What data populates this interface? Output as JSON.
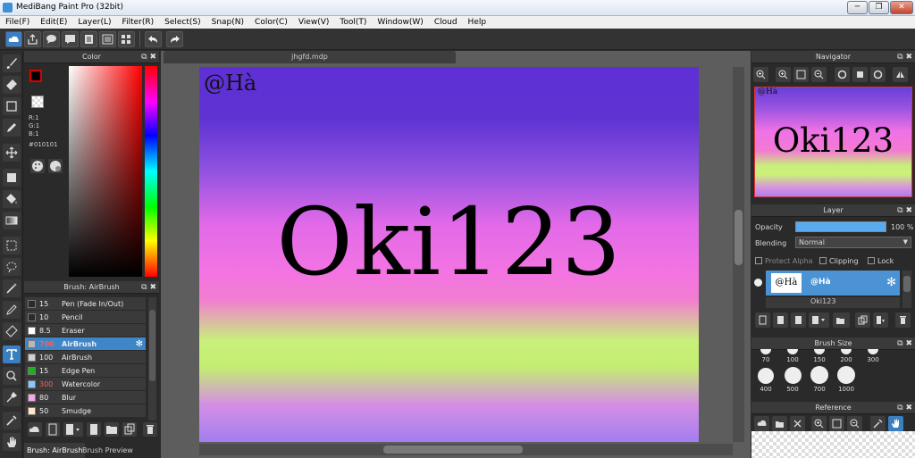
{
  "window": {
    "title": "MediBang Paint Pro (32bit)",
    "min_glyph": "─",
    "max_glyph": "❐",
    "close_glyph": "✕"
  },
  "menu": [
    "File(F)",
    "Edit(E)",
    "Layer(L)",
    "Filter(R)",
    "Select(S)",
    "Snap(N)",
    "Color(C)",
    "View(V)",
    "Tool(T)",
    "Window(W)",
    "Cloud",
    "Help"
  ],
  "panel_header_icons": "⧉ ✖",
  "color_panel": {
    "title": "Color",
    "rgb_lines": [
      "R:1",
      "G:1",
      "B:1"
    ],
    "hex": "#010101",
    "fg_color": "#010101"
  },
  "brush_panel": {
    "title": "Brush: AirBrush",
    "brushes": [
      {
        "size": "15",
        "name": "Pen (Fade In/Out)",
        "color": "#2a2a2a",
        "size_color": "#eeeeee",
        "active": false
      },
      {
        "size": "10",
        "name": "Pencil",
        "color": "#2a2a2a",
        "size_color": "#eeeeee",
        "active": false
      },
      {
        "size": "8.5",
        "name": "Eraser",
        "color": "#ffffff",
        "size_color": "#eeeeee",
        "active": false
      },
      {
        "size": "700",
        "name": "AirBrush",
        "color": "#b8b8b8",
        "size_color": "#f06262",
        "active": true
      },
      {
        "size": "100",
        "name": "AirBrush",
        "color": "#d0d0d0",
        "size_color": "#eeeeee",
        "active": false
      },
      {
        "size": "15",
        "name": "Edge Pen",
        "color": "#1db11d",
        "size_color": "#eeeeee",
        "active": false
      },
      {
        "size": "300",
        "name": "Watercolor",
        "color": "#8ac8ff",
        "size_color": "#f06262",
        "active": false
      },
      {
        "size": "80",
        "name": "Blur",
        "color": "#f7a6ea",
        "size_color": "#eeeeee",
        "active": false
      },
      {
        "size": "50",
        "name": "Smudge",
        "color": "#ffe8c8",
        "size_color": "#eeeeee",
        "active": false
      }
    ],
    "tabs": [
      "Brush: AirBrush",
      "Brush Preview"
    ],
    "gear_glyph": "✻"
  },
  "document": {
    "tab_title": "jhgfd.mdp",
    "watermark": "@Hà",
    "text": "Oki123"
  },
  "navigator": {
    "title": "Navigator",
    "watermark": "@Hà",
    "text": "Oki123"
  },
  "layer_panel": {
    "title": "Layer",
    "opacity_label": "Opacity",
    "opacity_value": "100 %",
    "opacity_fraction": 1.0,
    "blending_label": "Blending",
    "blending_value": "Normal",
    "blending_chevron": "▼",
    "protect_alpha": "Protect Alpha",
    "clipping": "Clipping",
    "lock": "Lock",
    "layers": [
      {
        "thumb": "@Hà",
        "name": "@Hà"
      },
      {
        "thumb": "",
        "name": "Oki123"
      }
    ]
  },
  "brush_size_panel": {
    "title": "Brush Size",
    "row1": [
      "70",
      "100",
      "150",
      "200",
      "300"
    ],
    "row2": [
      "400",
      "500",
      "700",
      "1000"
    ]
  },
  "reference_panel": {
    "title": "Reference"
  },
  "colors": {
    "accent": "#3f86c9",
    "panel_bg": "#2a2a2a",
    "canvas_bg": "#5d5d5d"
  }
}
